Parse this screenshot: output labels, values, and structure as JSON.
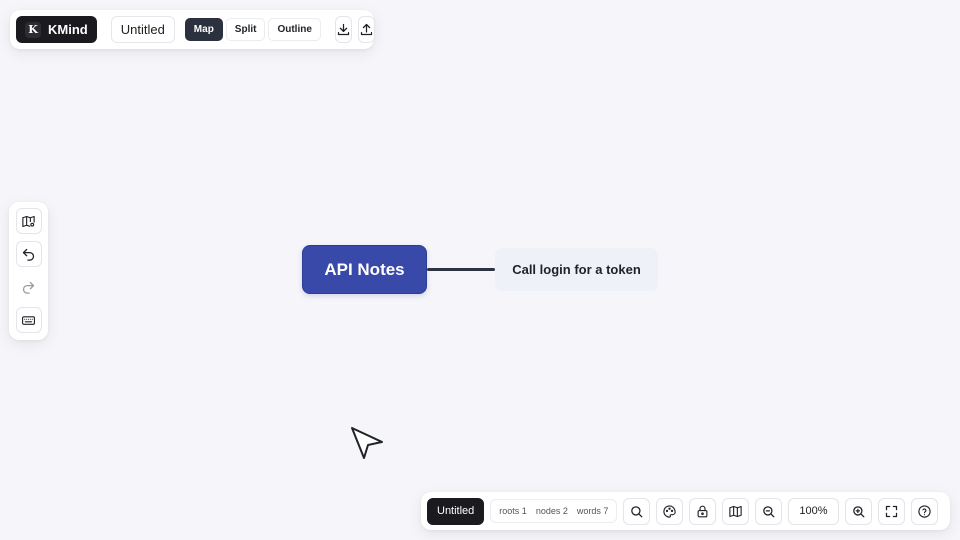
{
  "app": {
    "brand_letter": "K",
    "brand_name": "KMind",
    "document_title": "Untitled"
  },
  "view_modes": {
    "items": [
      {
        "label": "Map",
        "active": true
      },
      {
        "label": "Split",
        "active": false
      },
      {
        "label": "Outline",
        "active": false
      }
    ]
  },
  "top_actions": {
    "export_icon": "download-icon",
    "import_icon": "upload-icon"
  },
  "left_toolbar": {
    "icons": [
      "map-settings-icon",
      "undo-icon",
      "redo-icon",
      "keyboard-icon"
    ]
  },
  "mindmap": {
    "root_label": "API Notes",
    "child_label": "Call login for a token",
    "root_color": "#3949a9",
    "child_bg": "#eef1f7",
    "edge_color": "#2f3340"
  },
  "status": {
    "doc_name": "Untitled",
    "roots": "roots 1",
    "nodes": "nodes 2",
    "words": "words 7",
    "zoom": "100%"
  }
}
